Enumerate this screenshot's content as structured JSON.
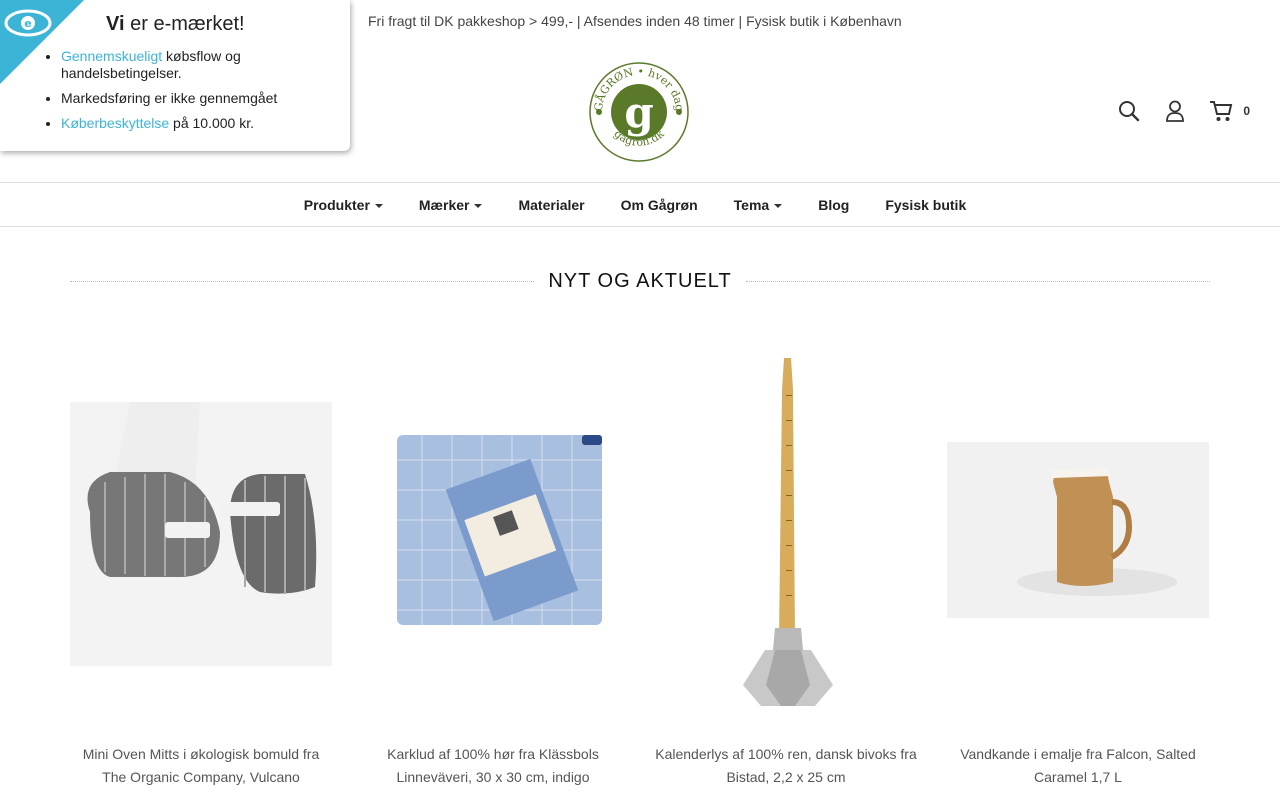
{
  "topbar": {
    "text": "Fri fragt til DK pakkeshop > 499,- | Afsendes inden 48 timer | Fysisk butik i København"
  },
  "logo": {
    "ring_text_top": "GÅGRØN • hver dag",
    "ring_text_bottom": "gagron.dk",
    "letter": "g",
    "color": "#5a7a2a"
  },
  "header": {
    "cart_count": "0"
  },
  "nav": {
    "items": [
      {
        "label": "Produkter",
        "dropdown": true
      },
      {
        "label": "Mærker",
        "dropdown": true
      },
      {
        "label": "Materialer",
        "dropdown": false
      },
      {
        "label": "Om Gågrøn",
        "dropdown": false
      },
      {
        "label": "Tema",
        "dropdown": true
      },
      {
        "label": "Blog",
        "dropdown": false
      },
      {
        "label": "Fysisk butik",
        "dropdown": false
      }
    ]
  },
  "section": {
    "title": "NYT OG AKTUELT"
  },
  "products": [
    {
      "title": "Mini Oven Mitts i økologisk bomuld fra The Organic Company, Vulcano"
    },
    {
      "title": "Karklud af 100% hør fra Klässbols Linneväveri, 30 x 30 cm, indigo"
    },
    {
      "title": "Kalenderlys af 100% ren, dansk bivoks fra Bistad, 2,2 x 25 cm"
    },
    {
      "title": "Vandkande i emalje fra Falcon, Salted Caramel 1,7 L"
    }
  ],
  "emark": {
    "head_bold": "Vi",
    "head_rest": " er e-mærket!",
    "items": [
      {
        "link": "Gennemskueligt",
        "rest": " købsflow og handelsbetingelser."
      },
      {
        "link": "",
        "rest": "Markedsføring er ikke gennemgået"
      },
      {
        "link": "Køberbeskyttelse",
        "rest": " på 10.000 kr."
      }
    ],
    "accent": "#3cb4d6"
  }
}
